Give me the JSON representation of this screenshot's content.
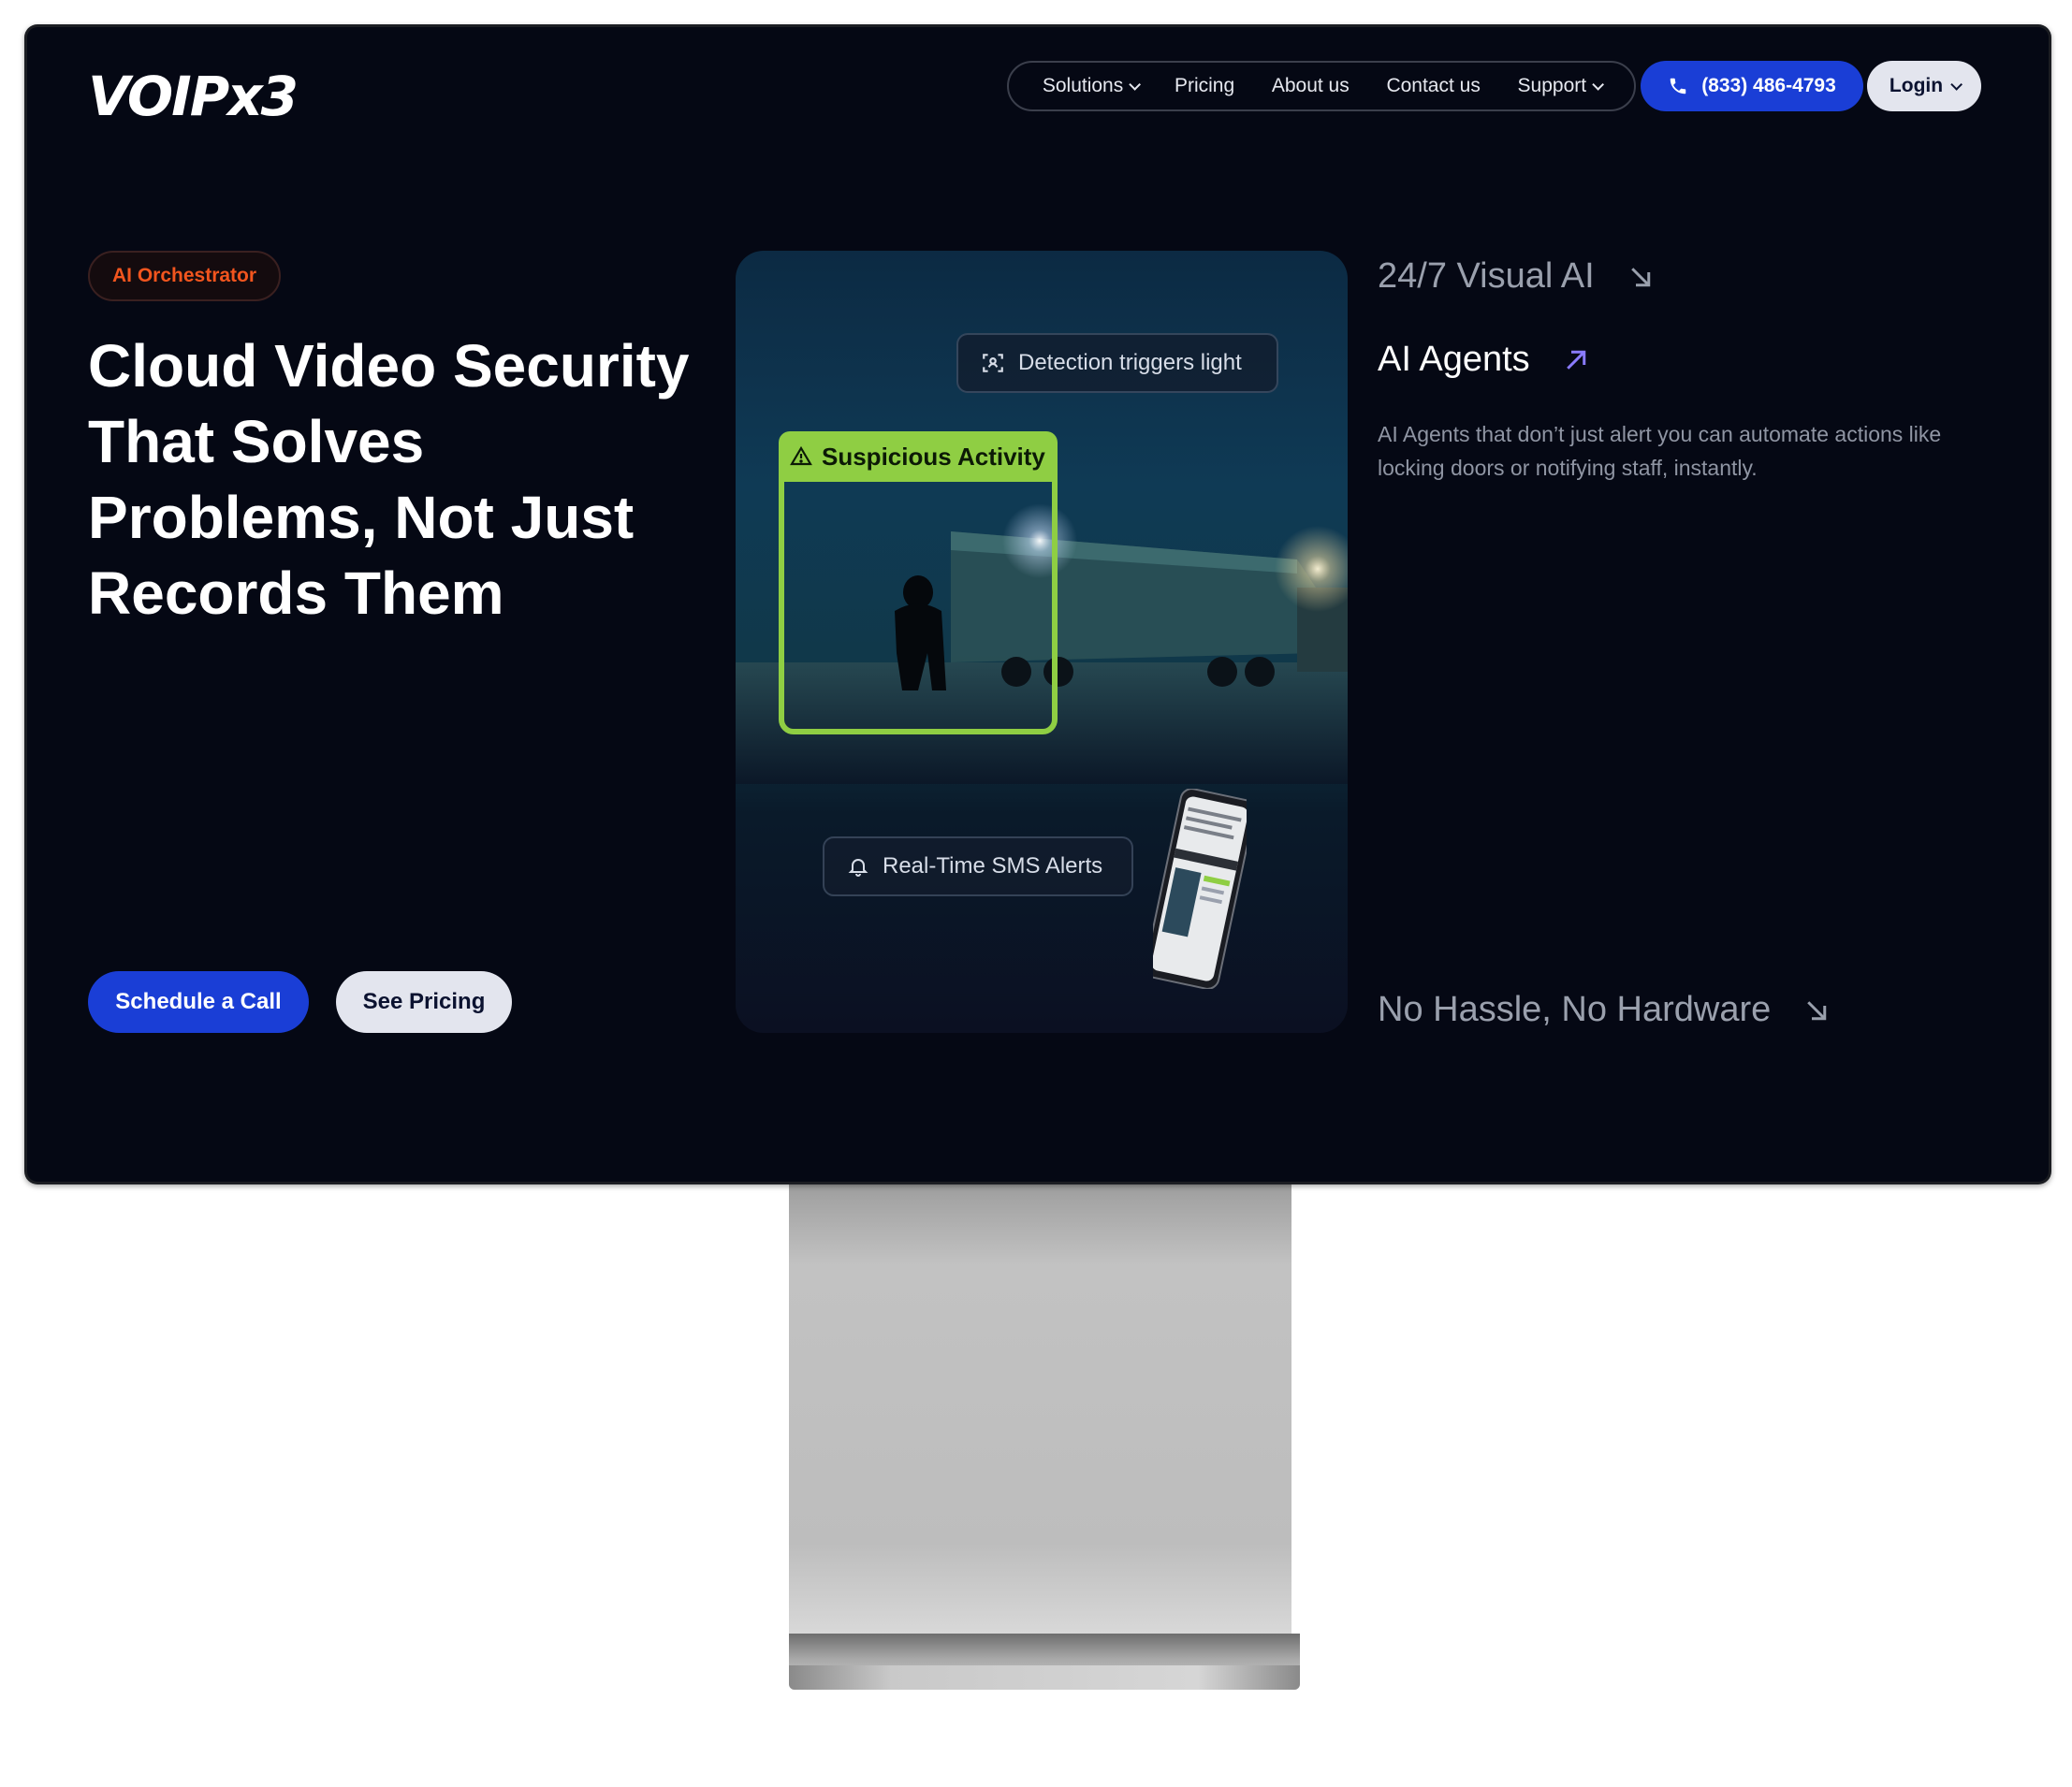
{
  "brand": {
    "logo_text": "VOIPx3"
  },
  "nav": {
    "items": [
      {
        "label": "Solutions",
        "has_dropdown": true
      },
      {
        "label": "Pricing",
        "has_dropdown": false
      },
      {
        "label": "About us",
        "has_dropdown": false
      },
      {
        "label": "Contact us",
        "has_dropdown": false
      },
      {
        "label": "Support",
        "has_dropdown": true
      }
    ],
    "phone": "(833) 486-4793",
    "login": "Login"
  },
  "hero": {
    "badge": "AI Orchestrator",
    "headline": "Cloud Video Security That Solves Problems, Not Just Records Them",
    "cta_primary": "Schedule a Call",
    "cta_secondary": "See Pricing"
  },
  "media": {
    "detection_pill": "Detection triggers light",
    "detection_label": "Suspicious Activity",
    "sms_pill": "Real-Time SMS Alerts"
  },
  "features": {
    "item1": "24/7 Visual AI",
    "item2": "AI Agents",
    "item2_desc": "AI Agents that don’t just alert you can automate actions like locking doors or notifying staff, instantly.",
    "item3": "No Hassle, No Hardware"
  },
  "colors": {
    "accent_blue": "#1a3ed6",
    "badge_orange": "#f2551e",
    "detection_green": "#8fce43",
    "screen_bg": "#050814"
  }
}
